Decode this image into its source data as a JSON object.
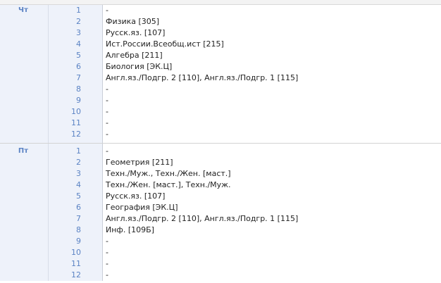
{
  "days": [
    {
      "name": "Чт",
      "lessons": [
        {
          "num": "1",
          "text": "-"
        },
        {
          "num": "2",
          "text": "Физика [305]"
        },
        {
          "num": "3",
          "text": "Русск.яз. [107]"
        },
        {
          "num": "4",
          "text": "Ист.России.Всеобщ.ист [215]"
        },
        {
          "num": "5",
          "text": "Алгебра [211]"
        },
        {
          "num": "6",
          "text": "Биология [ЭК.Ц]"
        },
        {
          "num": "7",
          "text": "Англ.яз./Подгр. 2 [110], Англ.яз./Подгр. 1 [115]"
        },
        {
          "num": "8",
          "text": "-"
        },
        {
          "num": "9",
          "text": "-"
        },
        {
          "num": "10",
          "text": "-"
        },
        {
          "num": "11",
          "text": "-"
        },
        {
          "num": "12",
          "text": "-"
        }
      ]
    },
    {
      "name": "Пт",
      "lessons": [
        {
          "num": "1",
          "text": "-"
        },
        {
          "num": "2",
          "text": "Геометрия [211]"
        },
        {
          "num": "3",
          "text": "Техн./Муж., Техн./Жен. [маст.]"
        },
        {
          "num": "4",
          "text": "Техн./Жен. [маст.], Техн./Муж."
        },
        {
          "num": "5",
          "text": "Русск.яз. [107]"
        },
        {
          "num": "6",
          "text": "География [ЭК.Ц]"
        },
        {
          "num": "7",
          "text": "Англ.яз./Подгр. 2 [110], Англ.яз./Подгр. 1 [115]"
        },
        {
          "num": "8",
          "text": "Инф. [109Б]"
        },
        {
          "num": "9",
          "text": "-"
        },
        {
          "num": "10",
          "text": "-"
        },
        {
          "num": "11",
          "text": "-"
        },
        {
          "num": "12",
          "text": "-"
        }
      ]
    }
  ]
}
